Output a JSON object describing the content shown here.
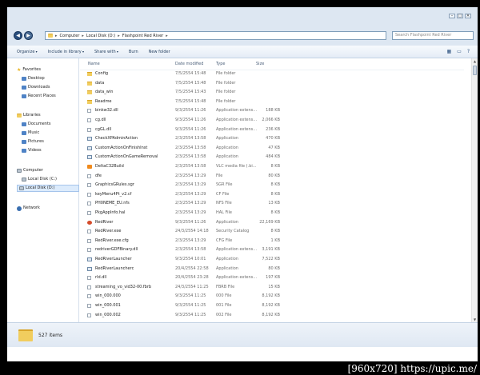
{
  "window": {
    "controls": [
      "–",
      "□",
      "✕"
    ],
    "breadcrumb": [
      "Computer",
      "Local Disk (D:)",
      "Flashpoint Red River"
    ],
    "search_placeholder": "Search Flashpoint Red River"
  },
  "toolbar": {
    "items": [
      "Organize",
      "Include in library",
      "Share with",
      "Burn",
      "New folder"
    ],
    "right_icons": [
      "view-icon",
      "preview-pane-icon",
      "help-icon"
    ]
  },
  "nav": {
    "favorites_label": "Favorites",
    "favorites": [
      "Desktop",
      "Downloads",
      "Recent Places"
    ],
    "libraries_label": "Libraries",
    "libraries": [
      "Documents",
      "Music",
      "Pictures",
      "Videos"
    ],
    "computer_label": "Computer",
    "drives": [
      "Local Disk (C:)",
      "Local Disk (D:)"
    ],
    "network_label": "Network"
  },
  "columns": {
    "name": "Name",
    "date": "Date modified",
    "type": "Type",
    "size": "Size"
  },
  "files": [
    {
      "name": "Config",
      "date": "7/5/2554 15:48",
      "type": "File folder",
      "size": "",
      "icon": "folder"
    },
    {
      "name": "data",
      "date": "7/5/2554 15:48",
      "type": "File folder",
      "size": "",
      "icon": "folder"
    },
    {
      "name": "data_win",
      "date": "7/5/2554 15:43",
      "type": "File folder",
      "size": "",
      "icon": "folder"
    },
    {
      "name": "Readme",
      "date": "7/5/2554 15:48",
      "type": "File folder",
      "size": "",
      "icon": "folder"
    },
    {
      "name": "binkw32.dll",
      "date": "9/3/2554 11:26",
      "type": "Application extens...",
      "size": "188 KB",
      "icon": "file"
    },
    {
      "name": "cg.dll",
      "date": "9/3/2554 11:26",
      "type": "Application extens...",
      "size": "2,066 KB",
      "icon": "file"
    },
    {
      "name": "cgGL.dll",
      "date": "9/3/2554 11:26",
      "type": "Application extens...",
      "size": "236 KB",
      "icon": "file"
    },
    {
      "name": "CheckXPAdminAction",
      "date": "2/3/2554 13:58",
      "type": "Application",
      "size": "470 KB",
      "icon": "app"
    },
    {
      "name": "CustomActionOnFinishInst",
      "date": "2/3/2554 13:58",
      "type": "Application",
      "size": "47 KB",
      "icon": "app"
    },
    {
      "name": "CustomActionOnGameRemoval",
      "date": "2/3/2554 13:58",
      "type": "Application",
      "size": "484 KB",
      "icon": "app"
    },
    {
      "name": "DeltaC32Build",
      "date": "2/3/2554 13:58",
      "type": "VLC media file (.bi...",
      "size": "8 KB",
      "icon": "vlc"
    },
    {
      "name": "dfe",
      "date": "2/3/2554 13:29",
      "type": "File",
      "size": "80 KB",
      "icon": "file"
    },
    {
      "name": "GraphicsGRules.sgr",
      "date": "2/3/2554 13:29",
      "type": "SGR File",
      "size": "8 KB",
      "icon": "file"
    },
    {
      "name": "keyMenu4Pt_v2.cf",
      "date": "2/3/2554 13:29",
      "type": "CF File",
      "size": "8 KB",
      "icon": "file"
    },
    {
      "name": "PH0NEME_EU.nfs",
      "date": "2/3/2554 13:29",
      "type": "NFS File",
      "size": "13 KB",
      "icon": "file"
    },
    {
      "name": "PkgAppInfo.hal",
      "date": "2/3/2554 13:29",
      "type": "HAL File",
      "size": "8 KB",
      "icon": "file"
    },
    {
      "name": "RedRiver",
      "date": "9/3/2554 11:26",
      "type": "Application",
      "size": "22,169 KB",
      "icon": "red"
    },
    {
      "name": "RedRiver.exe",
      "date": "24/3/2554 14:18",
      "type": "Security Catalog",
      "size": "8 KB",
      "icon": "file"
    },
    {
      "name": "RedRiver.exe.cfg",
      "date": "2/3/2554 13:29",
      "type": "CFG File",
      "size": "1 KB",
      "icon": "file"
    },
    {
      "name": "redriverGDFBinary.dll",
      "date": "2/3/2554 13:58",
      "type": "Application extens...",
      "size": "3,191 KB",
      "icon": "file"
    },
    {
      "name": "RedRiverLauncher",
      "date": "9/3/2554 10:01",
      "type": "Application",
      "size": "7,522 KB",
      "icon": "app"
    },
    {
      "name": "RedRiverLauncherc",
      "date": "20/4/2554 22:58",
      "type": "Application",
      "size": "80 KB",
      "icon": "app"
    },
    {
      "name": "rld.dll",
      "date": "20/4/2554 23:28",
      "type": "Application extens...",
      "size": "197 KB",
      "icon": "file"
    },
    {
      "name": "streaming_vo_vid32-00.fbrb",
      "date": "24/3/2554 11:25",
      "type": "FBRB File",
      "size": "15 KB",
      "icon": "file"
    },
    {
      "name": "win_000.000",
      "date": "9/3/2554 11:25",
      "type": "000 File",
      "size": "8,192 KB",
      "icon": "file"
    },
    {
      "name": "win_000.001",
      "date": "9/3/2554 11:25",
      "type": "001 File",
      "size": "8,192 KB",
      "icon": "file"
    },
    {
      "name": "win_000.002",
      "date": "9/3/2554 11:25",
      "type": "002 File",
      "size": "8,192 KB",
      "icon": "file"
    }
  ],
  "status": {
    "count": "527 items"
  },
  "watermark": "[960x720] https://upic.me/"
}
